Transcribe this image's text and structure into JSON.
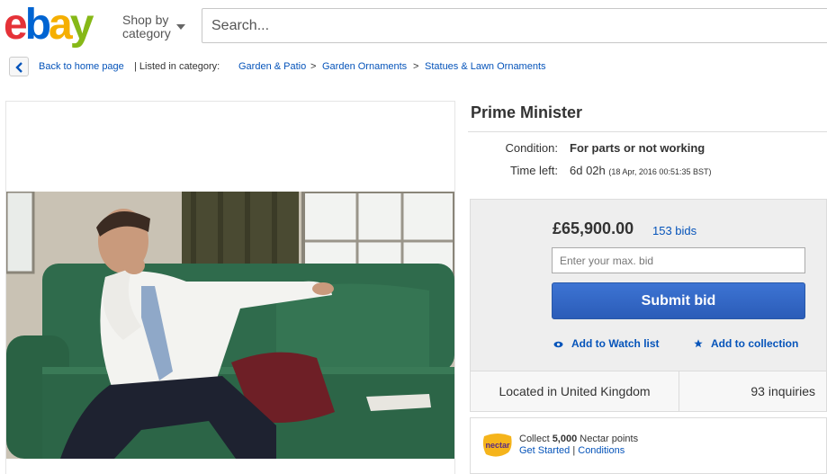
{
  "header": {
    "logo": {
      "e": "e",
      "b": "b",
      "a": "a",
      "y": "y"
    },
    "shop_by_line1": "Shop by",
    "shop_by_line2": "category",
    "search_placeholder": "Search..."
  },
  "breadcrumb": {
    "back_label": "Back to home page",
    "listed_label": "| Listed in category:",
    "categories": [
      "Garden & Patio",
      "Garden Ornaments",
      "Statues & Lawn Ornaments"
    ],
    "separator": ">"
  },
  "item": {
    "title": "Prime Minister",
    "condition_label": "Condition:",
    "condition_value": "For parts or not working",
    "time_left_label": "Time left:",
    "time_left_value": "6d 02h",
    "time_left_detail": "(18 Apr, 2016   00:51:35 BST)",
    "price": "£65,900.00",
    "bids": "153 bids",
    "bid_placeholder": "Enter your max. bid",
    "submit_label": "Submit bid",
    "watch_label": "Add to Watch list",
    "collection_label": "Add to collection",
    "location": "Located in United Kingdom",
    "inquiries": "93 inquiries"
  },
  "nectar": {
    "logo_text": "nectar",
    "collect_prefix": "Collect ",
    "points": "5,000",
    "collect_suffix": " Nectar points",
    "get_started": "Get Started",
    "divider": " | ",
    "conditions": "Conditions"
  },
  "colors": {
    "link": "#0654ba",
    "submit": "#3d74d3",
    "ebay_red": "#e53238",
    "ebay_blue": "#0064d2",
    "ebay_yellow": "#f5af02",
    "ebay_green": "#86b817"
  },
  "icons": {
    "back": "chevron-left-icon",
    "caret": "caret-down-icon",
    "watch": "eye-icon",
    "collection": "star-icon",
    "nectar": "nectar-logo"
  }
}
